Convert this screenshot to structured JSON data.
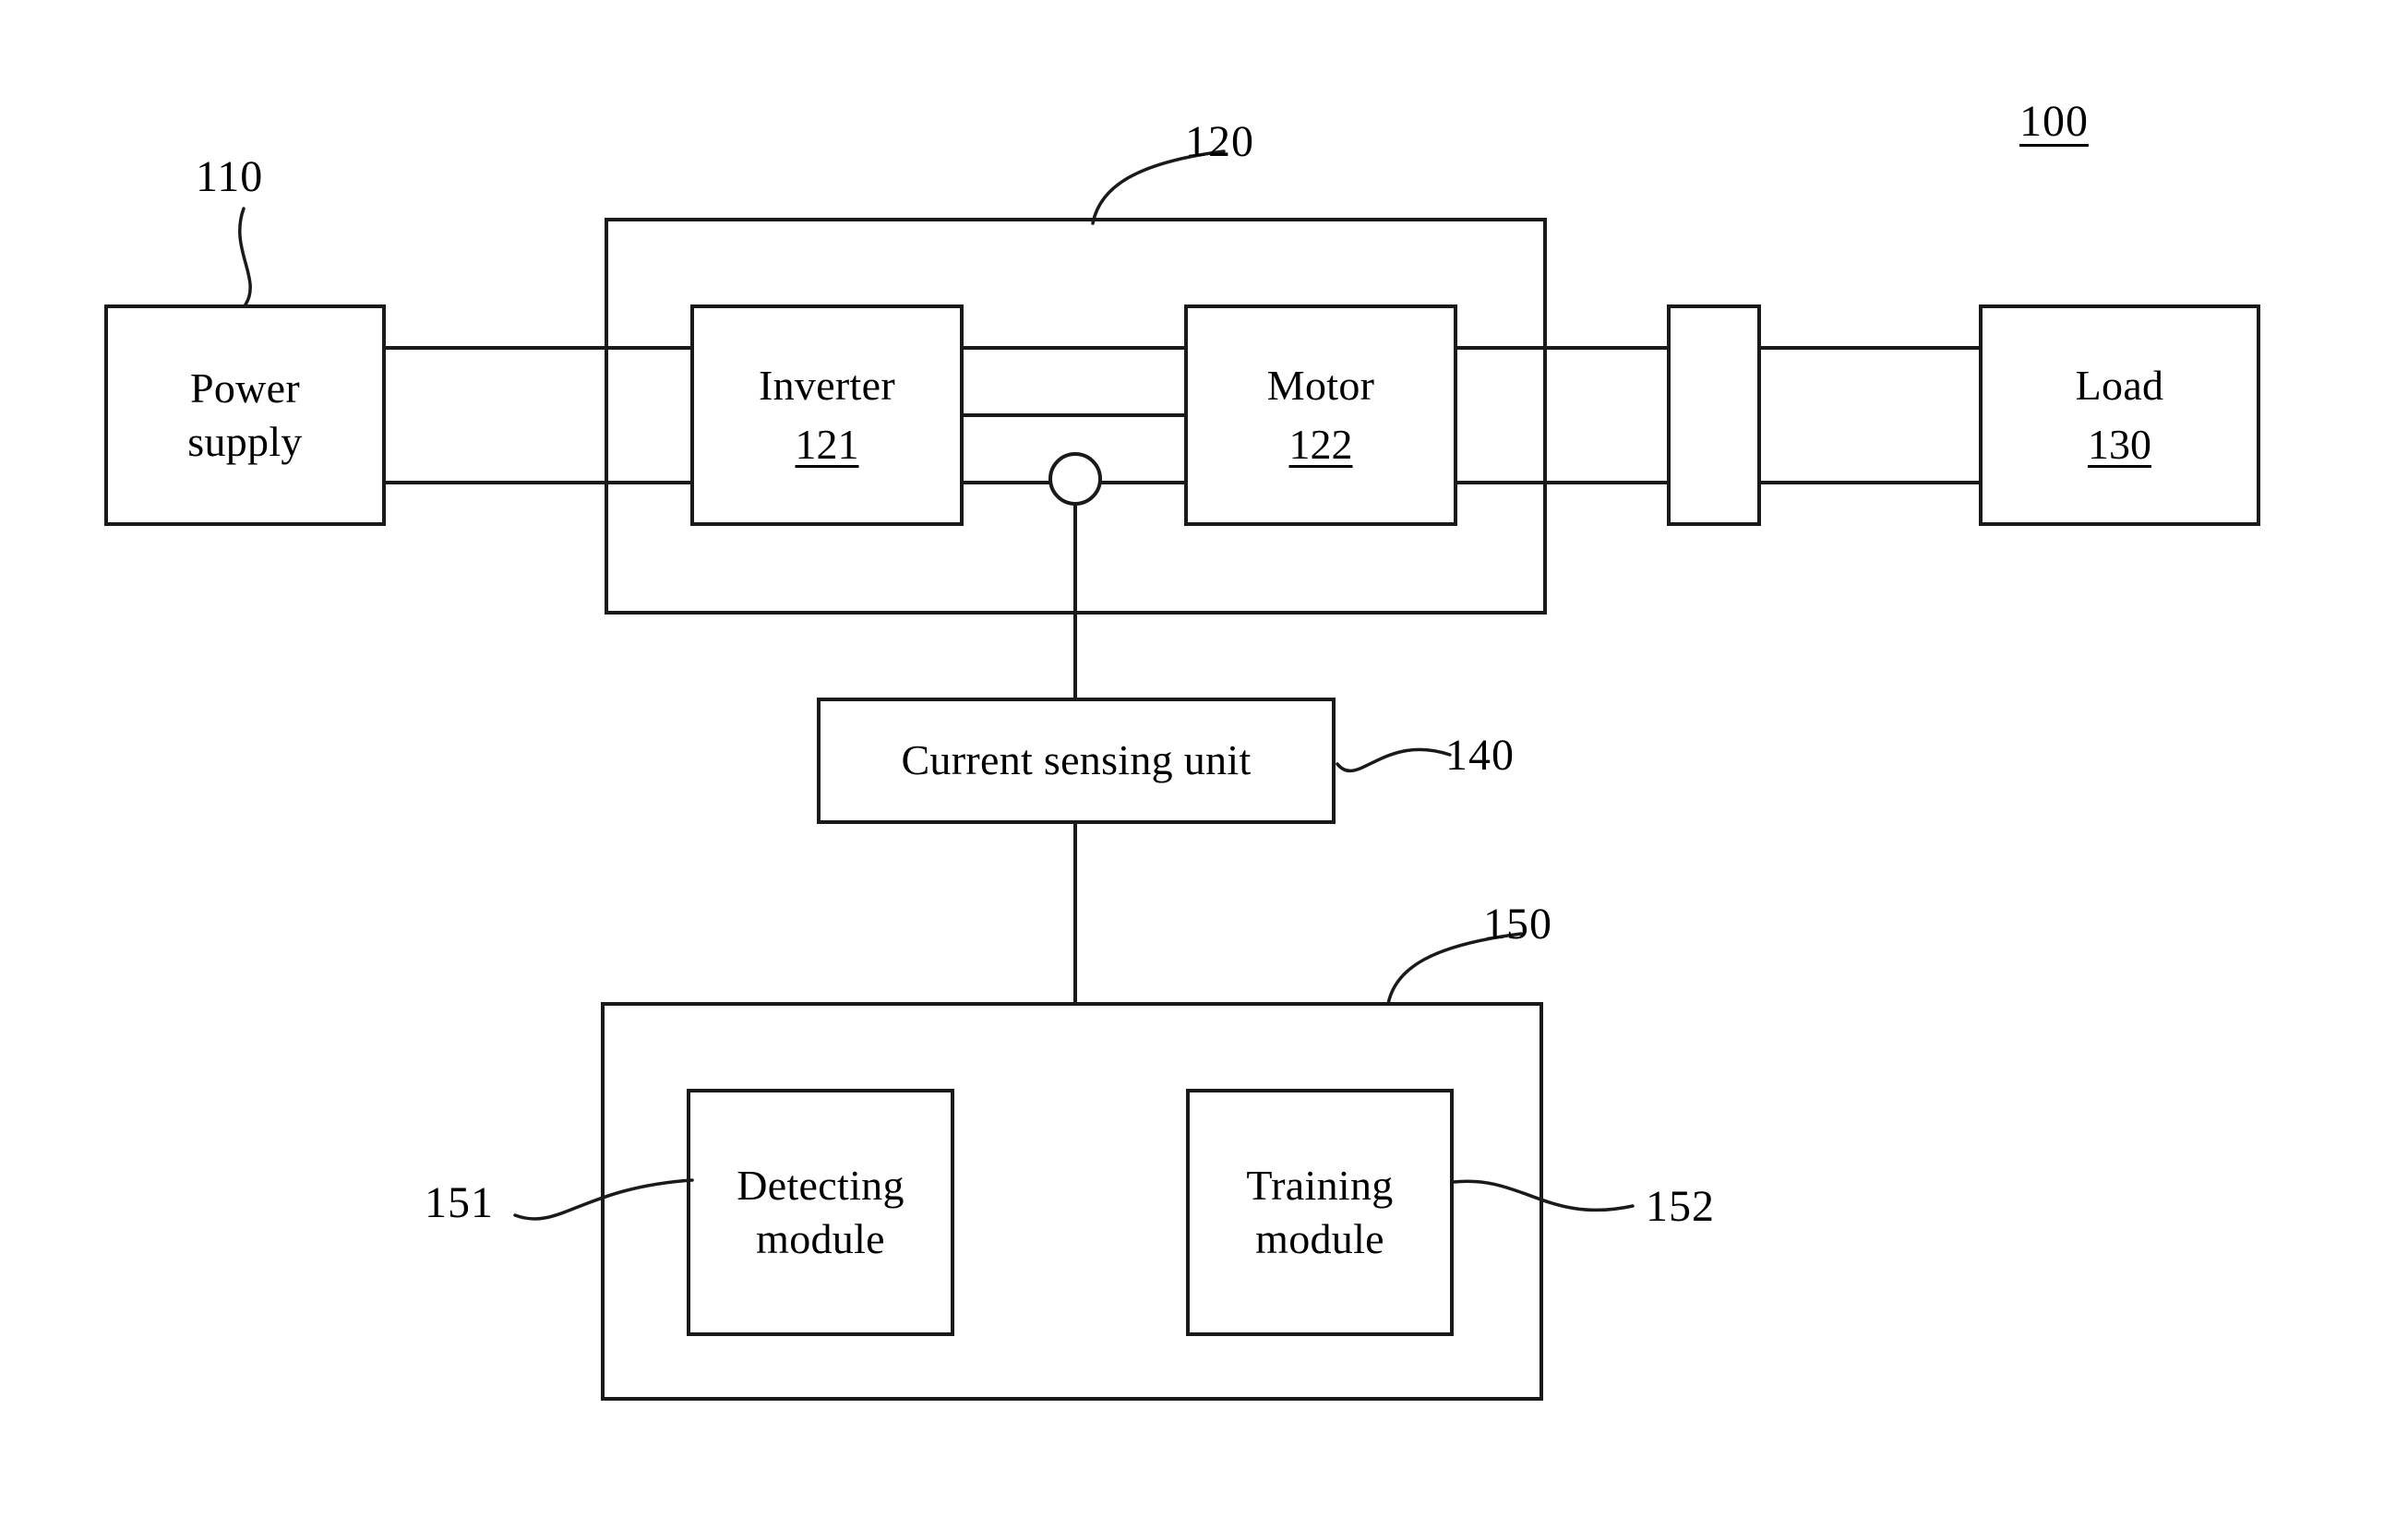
{
  "figure": {
    "type": "patent-block-diagram",
    "system_ref": "100",
    "blocks": {
      "power_supply": {
        "label_line1": "Power",
        "label_line2": "supply",
        "ref": "110"
      },
      "driving_unit": {
        "ref": "120"
      },
      "inverter": {
        "label": "Inverter",
        "ref": "121"
      },
      "motor": {
        "label": "Motor",
        "ref": "122"
      },
      "coupling": {
        "label": ""
      },
      "load": {
        "label": "Load",
        "ref": "130"
      },
      "current_sensing_unit": {
        "label": "Current sensing unit",
        "ref": "140"
      },
      "controller": {
        "ref": "150"
      },
      "detecting_module": {
        "label_line1": "Detecting",
        "label_line2": "module",
        "ref": "151"
      },
      "training_module": {
        "label_line1": "Training",
        "label_line2": "module",
        "ref": "152"
      }
    },
    "colors": {
      "line": "#1a1a1a",
      "background": "#ffffff"
    }
  }
}
